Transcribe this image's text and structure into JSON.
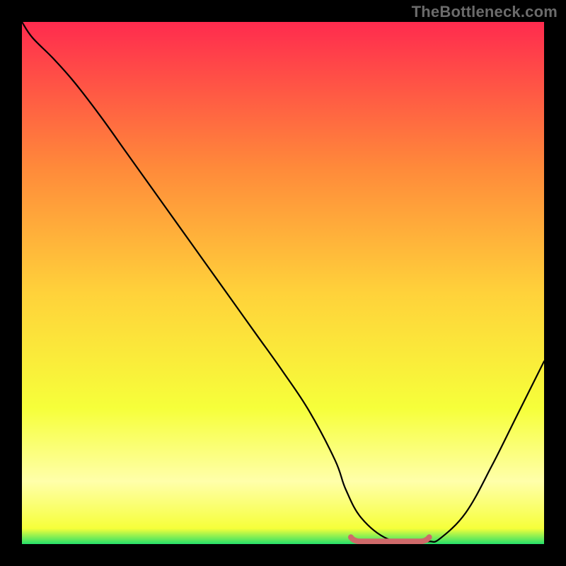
{
  "watermark": "TheBottleneck.com",
  "colors": {
    "bg": "#000000",
    "gradient_top": "#ff2b4e",
    "gradient_mid_upper": "#ff8a3a",
    "gradient_mid": "#ffd23a",
    "gradient_lower": "#f6ff3a",
    "gradient_pale": "#ffffaa",
    "gradient_bottom": "#25e06a",
    "curve": "#000000",
    "trough_marker": "#cf6a6a"
  },
  "chart_data": {
    "type": "line",
    "title": "",
    "xlabel": "",
    "ylabel": "",
    "xlim": [
      0,
      100
    ],
    "ylim": [
      0,
      100
    ],
    "x": [
      0,
      2,
      6,
      10,
      15,
      20,
      25,
      30,
      35,
      40,
      45,
      50,
      55,
      60,
      62,
      65,
      70,
      75,
      78,
      80,
      85,
      90,
      95,
      100
    ],
    "values": [
      100,
      97,
      93,
      88.5,
      82,
      75,
      68,
      61,
      54,
      47,
      40,
      33,
      25.5,
      16,
      10.5,
      5,
      1,
      0.5,
      0.5,
      1,
      6,
      15,
      25,
      35
    ],
    "trough_marker": {
      "x_start": 63,
      "x_end": 78,
      "y": 0.5
    }
  }
}
